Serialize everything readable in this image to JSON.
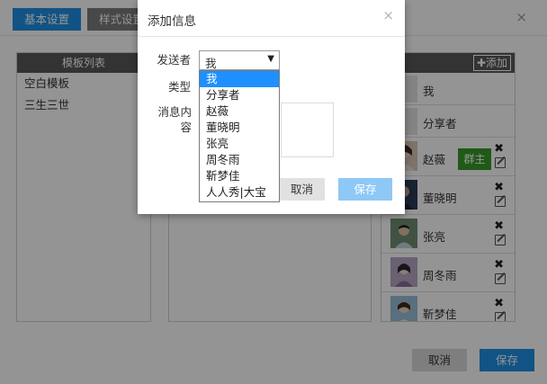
{
  "background": {
    "tabs": [
      {
        "label": "基本设置",
        "active": true
      },
      {
        "label": "样式设置",
        "active": false
      }
    ],
    "template_list": {
      "title": "模板列表",
      "items": [
        "空白模板",
        "三生三世"
      ]
    },
    "member_panel": {
      "add_label": "✚添加",
      "members": [
        {
          "name": "我",
          "role": ""
        },
        {
          "name": "分享者",
          "role": ""
        },
        {
          "name": "赵薇",
          "role": "群主"
        },
        {
          "name": "董晓明",
          "role": ""
        },
        {
          "name": "张亮",
          "role": ""
        },
        {
          "name": "周冬雨",
          "role": ""
        },
        {
          "name": "靳梦佳",
          "role": ""
        }
      ]
    },
    "footer": {
      "cancel_label": "取消",
      "save_label": "保存"
    }
  },
  "dialog": {
    "title": "添加信息",
    "close_glyph": "×",
    "sender_label": "发送者",
    "sender_value": "我",
    "type_label": "类型",
    "content_label_line1": "消息内",
    "content_label_line2": "容",
    "cancel_label": "取消",
    "save_label": "保存",
    "sender_options": [
      "我",
      "分享者",
      "赵薇",
      "董晓明",
      "张亮",
      "周冬雨",
      "靳梦佳",
      "人人秀|大宝"
    ]
  },
  "colors": {
    "primary": "#1f8fe5",
    "save_disabled": "#8dc8f7",
    "owner_badge": "#3a9a2b",
    "panel_header": "#595959",
    "dropdown_highlight": "#1e90ff"
  }
}
